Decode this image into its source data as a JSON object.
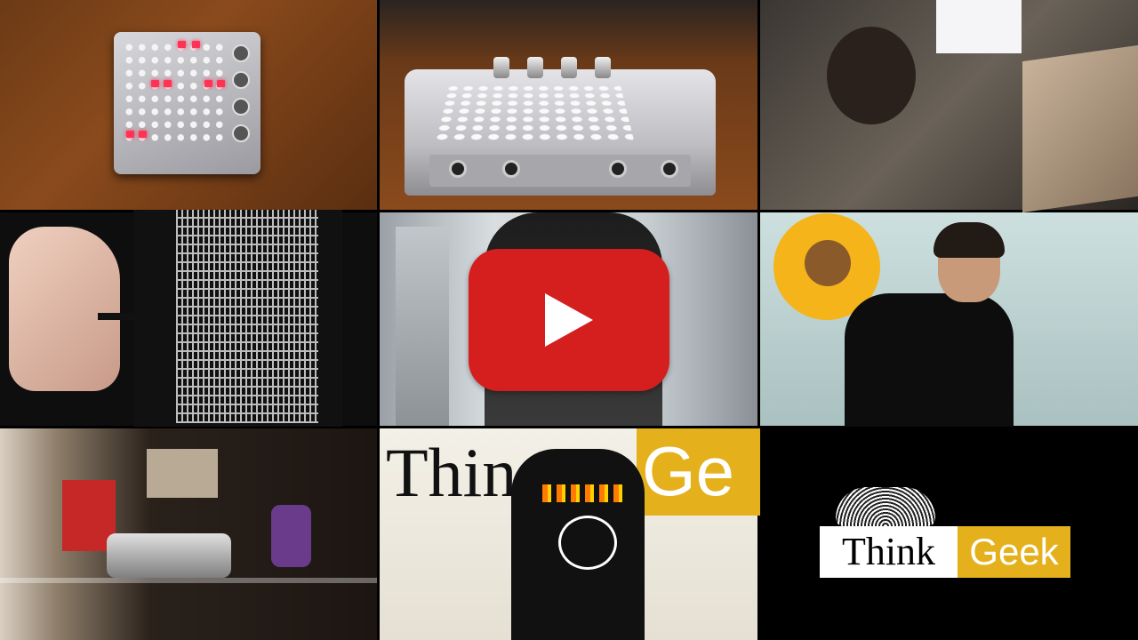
{
  "video": {
    "play_button_icon": "play-icon",
    "play_button_color": "#d51f1f"
  },
  "tiles": {
    "tile8_sign_left": "Thin",
    "tile8_sign_right": "Ge"
  },
  "logo": {
    "left_text": "Think",
    "right_text": "Geek",
    "brand_yellow": "#e4b11c",
    "brain_icon": "brain-icon"
  }
}
